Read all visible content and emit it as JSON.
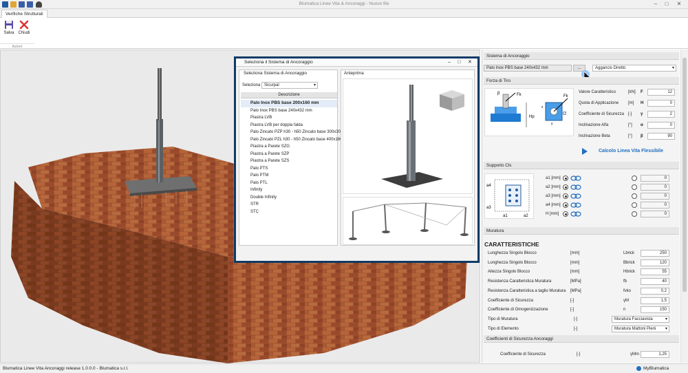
{
  "app_title": "Blumatica Linee Vita & Ancoraggi - Nuovo file",
  "ribbon": {
    "tab": "Verifiche Strutturali",
    "save_label": "Salva",
    "close_label": "Chiudi",
    "group_label": "Azioni"
  },
  "dialog": {
    "title": "Seleziona il Sistema di Ancoraggio",
    "left_header": "Seleziona Sistema di Ancoraggio",
    "select_label": "Seleziona",
    "select_value": "Sicurpal",
    "column_header": "Descrizione",
    "preview_header": "Anteprima",
    "items": [
      "Palo Inox PBS base 200x160 mm",
      "Palo Inox PBS base 240x432 mm",
      "Piastra LVB",
      "Piastra LVB per doppia falda",
      "Palo Zincato PZP h30 - h50  Zincato base 300x300",
      "Palo Zincato PZL h30 - h50  Zincato base 400x160",
      "Piastra a Parete SZG",
      "Piastra a Parete SZP",
      "Piastra a Parete SZS",
      "Palo PTS",
      "Palo PTM",
      "Palo PTL",
      "Infinity",
      "Double Infinity",
      "STR",
      "STC"
    ]
  },
  "panel": {
    "sistema": {
      "header": "Sistema di Ancoraggio",
      "value": "Palo Inox PBS base 240x432 mm",
      "browse": "...",
      "aggancio": "Aggancio Diretto"
    },
    "forza": {
      "header": "Forza di Tiro",
      "rows": [
        {
          "label": "Valore Caratteristico",
          "unit": "[kN]",
          "sym": "F",
          "value": "12"
        },
        {
          "label": "Quota di Applicazione",
          "unit": "[m]",
          "sym": "H",
          "value": "0"
        },
        {
          "label": "Coefficiente di Sicurezza",
          "unit": "[-]",
          "sym": "γ",
          "value": "2"
        },
        {
          "label": "Inclinazione Alfa",
          "unit": "[°]",
          "sym": "α",
          "value": "0"
        },
        {
          "label": "Inclinazione Beta",
          "unit": "[°]",
          "sym": "β",
          "value": "90"
        }
      ],
      "calc_link": "Calcolo Linea Vita Flessibile",
      "diagram_labels": {
        "fk": "Fk",
        "hp": "Hp",
        "alpha": "α",
        "beta": "β",
        "z": "z",
        "y": "y"
      }
    },
    "supporto": {
      "header": "Supporto Cls",
      "rows": [
        {
          "label": "a1 [mm]",
          "value": "0"
        },
        {
          "label": "a2 [mm]",
          "value": "0"
        },
        {
          "label": "a3 [mm]",
          "value": "0"
        },
        {
          "label": "a4 [mm]",
          "value": "0"
        },
        {
          "label": "H [mm]",
          "value": "0"
        }
      ],
      "diagram_labels": {
        "a1": "a1",
        "a2": "a2",
        "a3": "a3",
        "a4": "a4"
      }
    },
    "muratura": {
      "header": "Muratura",
      "title": "CARATTERISTICHE",
      "rows": [
        {
          "label": "Lunghezza Singolo Blocco",
          "unit": "[mm]",
          "sym": "Lbrick",
          "value": "250"
        },
        {
          "label": "Lunghezza Singolo Blocco",
          "unit": "[mm]",
          "sym": "Bbrick",
          "value": "120"
        },
        {
          "label": "Altezza Singolo Blocco",
          "unit": "[mm]",
          "sym": "Hbrick",
          "value": "55"
        },
        {
          "label": "Resistenza Caratteristica Muratura",
          "unit": "[MPa]",
          "sym": "fb",
          "value": "40"
        },
        {
          "label": "Resistenza Caratteristica a taglio Muratura",
          "unit": "[MPa]",
          "sym": "fvko",
          "value": "0,2"
        },
        {
          "label": "Coefficiente di Sicurezza",
          "unit": "[-]",
          "sym": "γM",
          "value": "1,5"
        },
        {
          "label": "Coefficiente di Omogenizzazione",
          "unit": "[-]",
          "sym": "n",
          "value": "150"
        }
      ],
      "tipo_muratura_label": "Tipo di Muratura",
      "tipo_muratura_unit": "[-]",
      "tipo_muratura": "Muratura Facciavista",
      "tipo_elemento_label": "Tipo di Elemento",
      "tipo_elemento_unit": "[-]",
      "tipo_elemento": "Muratura Mattoni Pieni"
    },
    "coeff": {
      "header": "Coefficienti di Sicurezza Ancoraggi",
      "label": "Coefficiente di Sicurezza",
      "unit": "[-]",
      "sym": "γMm",
      "value": "1,25"
    }
  },
  "status": {
    "left": "Blumatica Linee Vita  Ancoraggi release 1.0.0.0 - Blumatica s.r.l.",
    "user": "MyBlumatica"
  },
  "colors": {
    "dialog_frame": "#0f3a66",
    "link": "#1f6fc0",
    "brick": "#9a4a2c"
  },
  "icons": [
    "app-logo-icon",
    "open-icon",
    "save-icon",
    "save-as-icon",
    "user-icon",
    "save-icon",
    "close-icon",
    "cube-icon",
    "chain-icon",
    "radio-icon"
  ]
}
